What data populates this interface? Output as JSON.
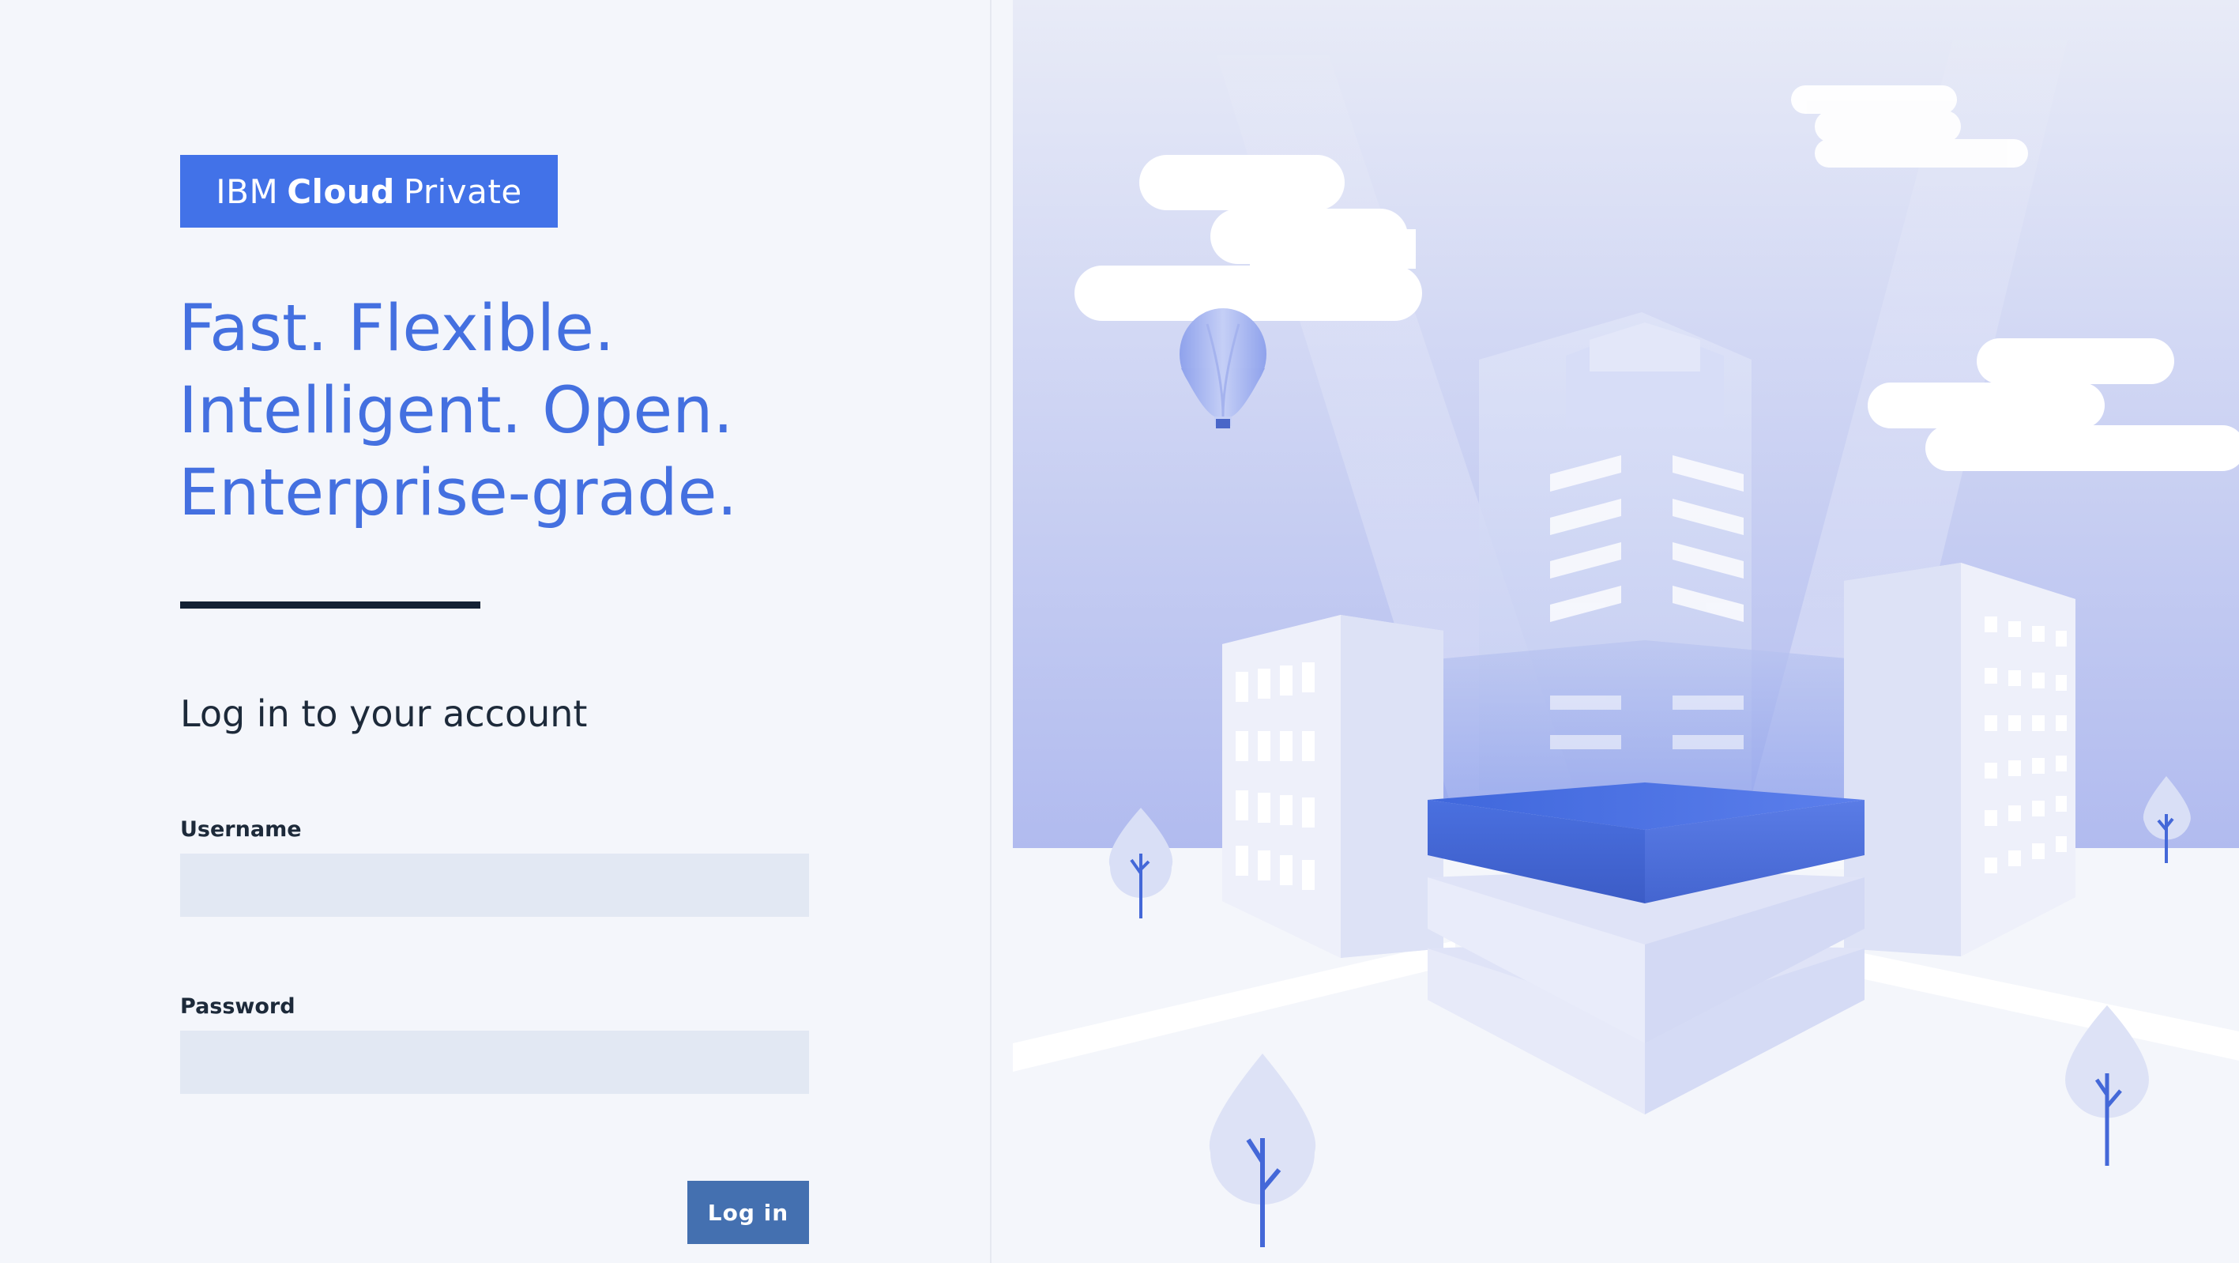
{
  "brand": {
    "prefix": "IBM",
    "bold": "Cloud",
    "suffix": "Private"
  },
  "tagline": {
    "line1": "Fast. Flexible.",
    "line2": "Intelligent. Open.",
    "line3": "Enterprise-grade."
  },
  "login": {
    "heading": "Log in to your account",
    "username_label": "Username",
    "username_value": "",
    "password_label": "Password",
    "password_value": "",
    "submit_label": "Log in"
  },
  "colors": {
    "accent": "#4272e8",
    "button": "#4470b0",
    "input_bg": "#e2e8f3",
    "heading_text": "#1d2a3a",
    "background": "#f4f6fb"
  },
  "illustration": {
    "icons": [
      "cloud",
      "hot-air-balloon",
      "building",
      "tree",
      "data-platform"
    ]
  }
}
